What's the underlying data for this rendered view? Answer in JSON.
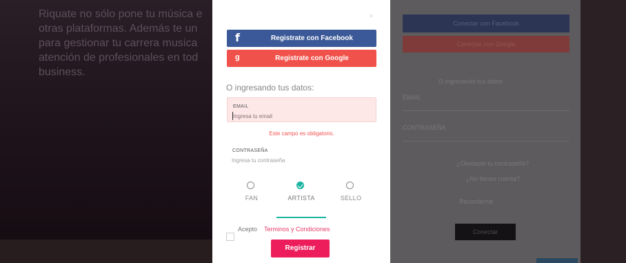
{
  "background_left": {
    "hero_text": "Riquate no sólo pone tu música e\notras plataformas. Además te un\npara gestionar tu carrera musica\natención de profesionales en tod\nbusiness."
  },
  "background_right": {
    "facebook_label": "Conectar con Facebook",
    "google_label": "Conectar con Google",
    "or_text": "O ingresando tus datos",
    "email_label": "EMAIL",
    "password_label": "CONTRASEÑA",
    "forgot_text": "¿Olvidaste tu contraseña?",
    "register_text": "¿No tienes cuenta?",
    "remember_text": "Recordarme",
    "connect_label": "Conectar"
  },
  "modal": {
    "close_icon": "close-icon",
    "facebook_button": {
      "icon": "f",
      "label": "Registrate con Facebook",
      "color": "#3b5998"
    },
    "google_button": {
      "icon": "g",
      "label": "Registrate con Google",
      "color": "#f0524b"
    },
    "or_text": "O ingresando tus datos:",
    "email": {
      "label": "EMAIL",
      "placeholder": "Ingresa tu email",
      "value": "",
      "error": "Este campo es obligatorio."
    },
    "password": {
      "label": "CONTRASEÑA",
      "placeholder": "Ingresa tu contraseña",
      "value": ""
    },
    "roles": [
      {
        "label": "FAN",
        "selected": false
      },
      {
        "label": "ARTISTA",
        "selected": true
      },
      {
        "label": "SELLO",
        "selected": false
      }
    ],
    "terms": {
      "prefix": "Acepto",
      "link": "Terminos y Condiciones",
      "checked": false
    },
    "submit_label": "Registrar",
    "accent_color": "#19b4a0",
    "primary_color": "#ec1d5a"
  }
}
